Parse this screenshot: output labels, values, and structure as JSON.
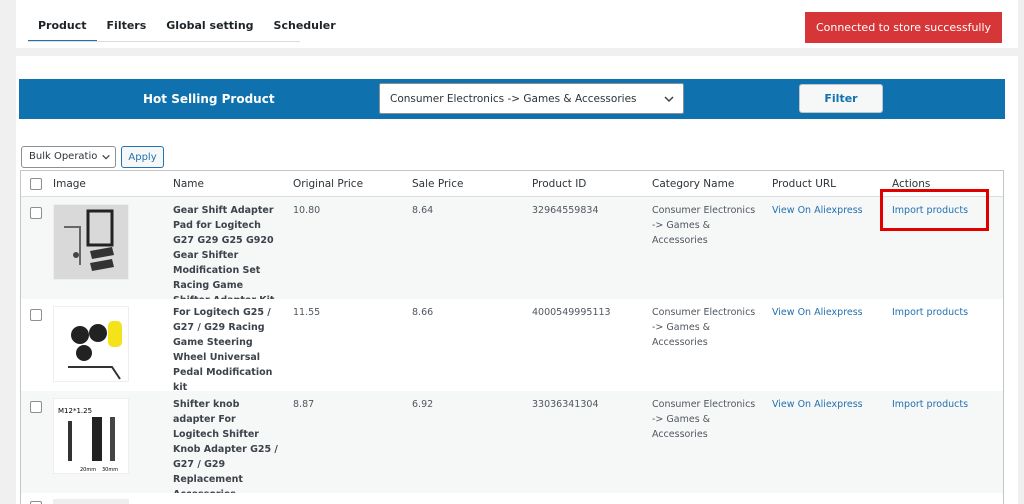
{
  "tabs": [
    {
      "label": "Product"
    },
    {
      "label": "Filters"
    },
    {
      "label": "Global setting"
    },
    {
      "label": "Scheduler"
    }
  ],
  "status_badge": "Connected to store successfully",
  "hot_selling": {
    "title": "Hot Selling Product",
    "category_selected": "Consumer Electronics -> Games & Accessories",
    "filter_label": "Filter"
  },
  "bulk": {
    "selected": "Bulk Operatio",
    "apply_label": "Apply"
  },
  "table": {
    "headers": [
      "Image",
      "Name",
      "Original Price",
      "Sale Price",
      "Product ID",
      "Category Name",
      "Product URL",
      "Actions"
    ],
    "rows": [
      {
        "name": "Gear Shift Adapter Pad for Logitech G27 G29 G25 G920 Gear Shifter Modification Set Racing Game Shifter Adapter Kit",
        "original_price": "10.80",
        "sale_price": "8.64",
        "product_id": "32964559834",
        "category": "Consumer Electronics -> Games & Accessories",
        "url_label": "View On Aliexpress",
        "action_label": "Import products"
      },
      {
        "name": "For Logitech G25 / G27 / G29 Racing Game Steering Wheel Universal Pedal Modification kit",
        "original_price": "11.55",
        "sale_price": "8.66",
        "product_id": "4000549995113",
        "category": "Consumer Electronics -> Games & Accessories",
        "url_label": "View On Aliexpress",
        "action_label": "Import products"
      },
      {
        "name": "Shifter knob adapter For Logitech Shifter Knob Adapter G25 / G27 / G29 Replacement Accessories",
        "original_price": "8.87",
        "sale_price": "6.92",
        "product_id": "33036341304",
        "category": "Consumer Electronics -> Games & Accessories",
        "url_label": "View On Aliexpress",
        "action_label": "Import products"
      }
    ],
    "thumb_captions": {
      "row3_label": "M12*1.25",
      "row3_sizes": [
        "20mm",
        "30mm"
      ]
    }
  },
  "colors": {
    "accent": "#0f72ae",
    "link": "#2271b1",
    "status_error": "#d63638",
    "highlight": "#e00000"
  }
}
